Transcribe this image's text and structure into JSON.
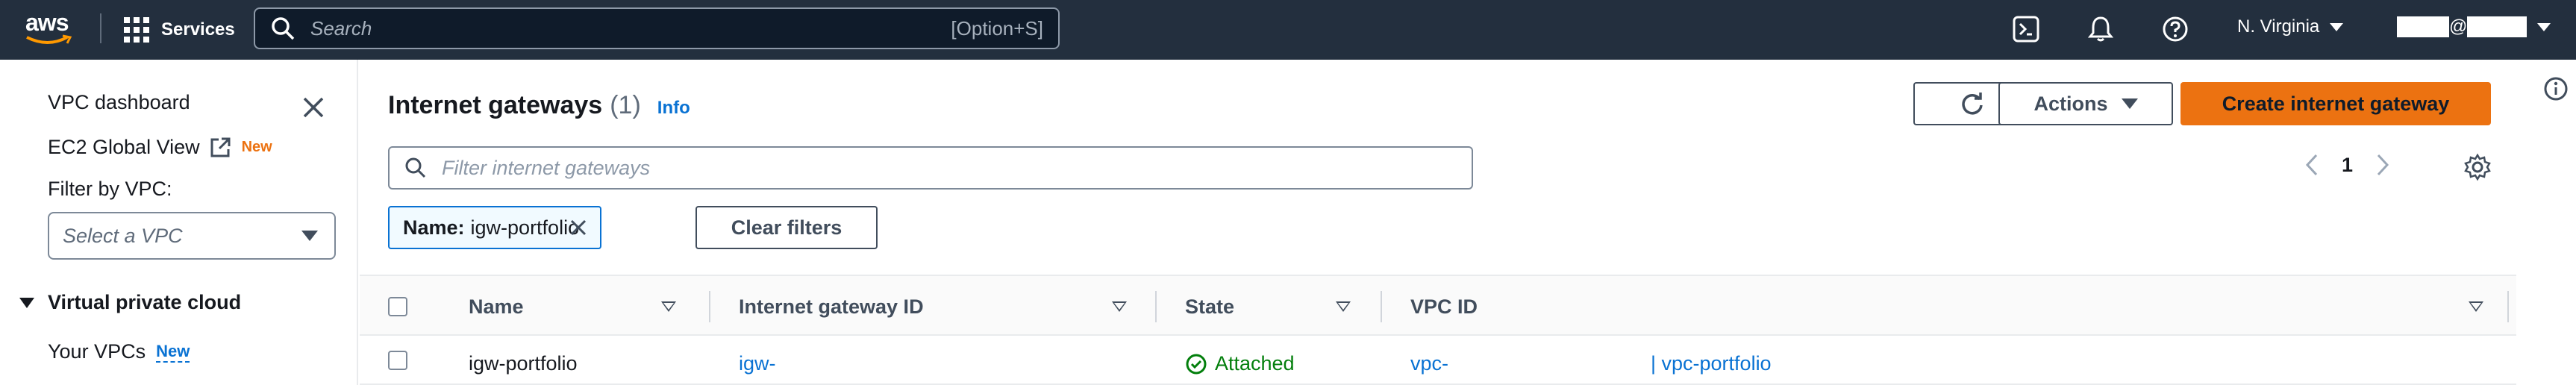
{
  "topbar": {
    "logo_text": "aws",
    "services_label": "Services",
    "search_placeholder": "Search",
    "search_shortcut": "[Option+S]",
    "region": "N. Virginia",
    "account_at": "@"
  },
  "sidebar": {
    "dashboard": "VPC dashboard",
    "ec2_global_view": "EC2 Global View",
    "ec2_badge": "New",
    "filter_label": "Filter by VPC:",
    "select_placeholder": "Select a VPC",
    "section_title": "Virtual private cloud",
    "your_vpcs": "Your VPCs",
    "your_vpcs_badge": "New"
  },
  "main": {
    "title": "Internet gateways",
    "count": "(1)",
    "info": "Info",
    "actions_label": "Actions",
    "create_label": "Create internet gateway",
    "filter_placeholder": "Filter internet gateways",
    "page_number": "1",
    "token_key": "Name:",
    "token_value": "igw-portfolio",
    "clear_filters": "Clear filters"
  },
  "table": {
    "headers": [
      "Name",
      "Internet gateway ID",
      "State",
      "VPC ID"
    ],
    "rows": [
      {
        "name": "igw-portfolio",
        "gateway_id": "igw-",
        "state": "Attached",
        "vpc_id": "vpc-",
        "vpc_name": "| vpc-portfolio"
      }
    ]
  },
  "colors": {
    "topbar_bg": "#232f3e",
    "primary_button": "#ec7211",
    "link": "#0972d3",
    "success": "#037f0c"
  }
}
